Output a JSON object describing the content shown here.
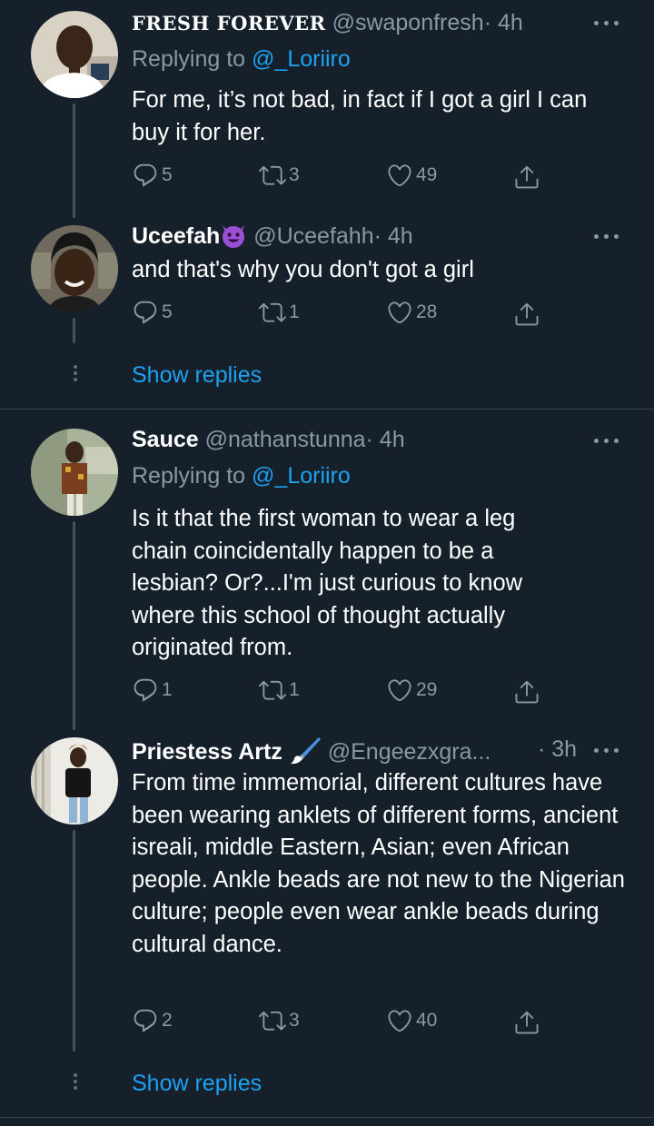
{
  "colors": {
    "background": "#15202b",
    "text_primary": "#ffffff",
    "text_secondary": "#8899a6",
    "link": "#1da1f2",
    "thread_line": "#3d5466"
  },
  "tweets": [
    {
      "name": "FRESH FOREVER",
      "handle": "@swaponfresh",
      "time": "· 4h",
      "replying_label": "Replying to",
      "replying_to": "@_Loriiro",
      "text": "For me, it’s not bad, in fact if I got a girl I can buy it for her.",
      "replies": "5",
      "retweets": "3",
      "likes": "49"
    },
    {
      "name": "Uceefah",
      "name_emoji": "smiling-devil-emoji",
      "handle": "@Uceefahh",
      "time": "· 4h",
      "text": "and that's why you don't got a girl",
      "replies": "5",
      "retweets": "1",
      "likes": "28"
    },
    {
      "name": "Sauce",
      "handle": "@nathanstunna",
      "time": "· 4h",
      "replying_label": "Replying to",
      "replying_to": "@_Loriiro",
      "text": "Is it that the first woman to wear a leg chain coincidentally happen to be a lesbian? Or?...I'm just curious to know where this school of thought actually originated from.",
      "replies": "1",
      "retweets": "1",
      "likes": "29"
    },
    {
      "name": "Priestess Artz",
      "name_emoji": "paintbrush-emoji",
      "handle": "@Engeezxgra...",
      "time": "· 3h",
      "text": "From time immemorial, different cultures have been wearing anklets of different forms, ancient isreali, middle Eastern, Asian; even African people. Ankle beads are not new to the Nigerian culture; people even wear ankle beads during cultural dance.",
      "replies": "2",
      "retweets": "3",
      "likes": "40"
    }
  ],
  "show_replies_1": "Show replies",
  "show_replies_2": "Show replies"
}
